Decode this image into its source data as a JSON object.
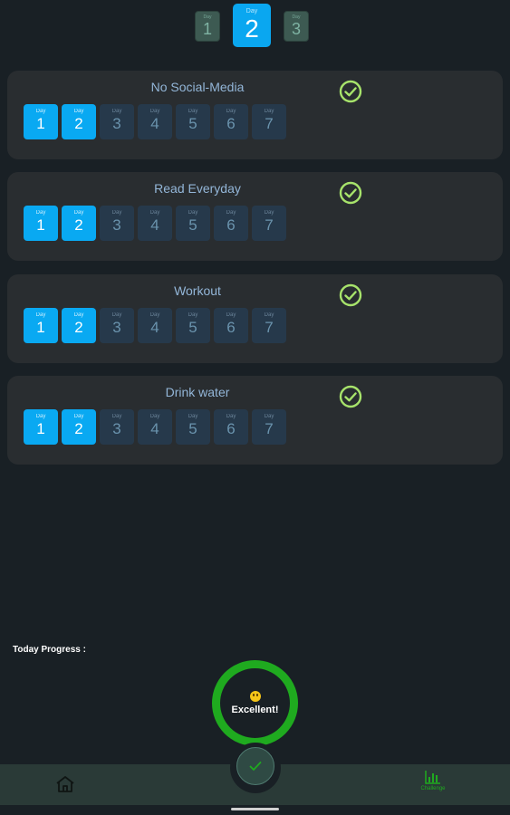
{
  "top_days": [
    {
      "label": "Day",
      "number": "1",
      "selected": false
    },
    {
      "label": "Day",
      "number": "2",
      "selected": true
    },
    {
      "label": "Day",
      "number": "3",
      "selected": false
    }
  ],
  "challenges": [
    {
      "title": "No Social-Media",
      "completed": true
    },
    {
      "title": "Read Everyday",
      "completed": true
    },
    {
      "title": "Workout",
      "completed": true
    },
    {
      "title": "Drink water",
      "completed": true
    }
  ],
  "day_cells": [
    {
      "label": "Day",
      "number": "1",
      "done": true
    },
    {
      "label": "Day",
      "number": "2",
      "done": true
    },
    {
      "label": "Day",
      "number": "3",
      "done": false
    },
    {
      "label": "Day",
      "number": "4",
      "done": false
    },
    {
      "label": "Day",
      "number": "5",
      "done": false
    },
    {
      "label": "Day",
      "number": "6",
      "done": false
    },
    {
      "label": "Day",
      "number": "7",
      "done": false
    }
  ],
  "progress": {
    "label": "Today Progress :",
    "status": "Excellent!",
    "emoji": "smiley-emoji-icon"
  },
  "nav": {
    "home_icon": "home-icon",
    "fab_icon": "check-icon",
    "challenge_icon": "bar-chart-icon",
    "challenge_label": "Challenge"
  },
  "colors": {
    "background": "#192025",
    "card": "#292d30",
    "accent_blue": "#09a9f2",
    "progress_green": "#1faa1f",
    "check_green": "#a7e36b"
  }
}
